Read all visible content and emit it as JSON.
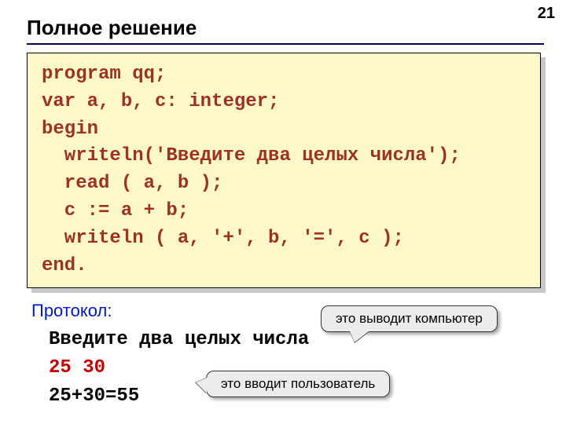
{
  "page_number": "21",
  "title": "Полное решение",
  "code": "program qq;\nvar a, b, c: integer;\nbegin\n  writeln('Введите два целых числа');\n  read ( a, b );\n  c := a + b;\n  writeln ( a, '+', b, '=', c );\nend.",
  "protocol_label": "Протокол:",
  "protocol": {
    "prompt": "Введите два целых числа",
    "user_input": "25 30",
    "output": "25+30=55"
  },
  "callouts": {
    "computer": "это выводит компьютер",
    "user": "это вводит пользователь"
  }
}
